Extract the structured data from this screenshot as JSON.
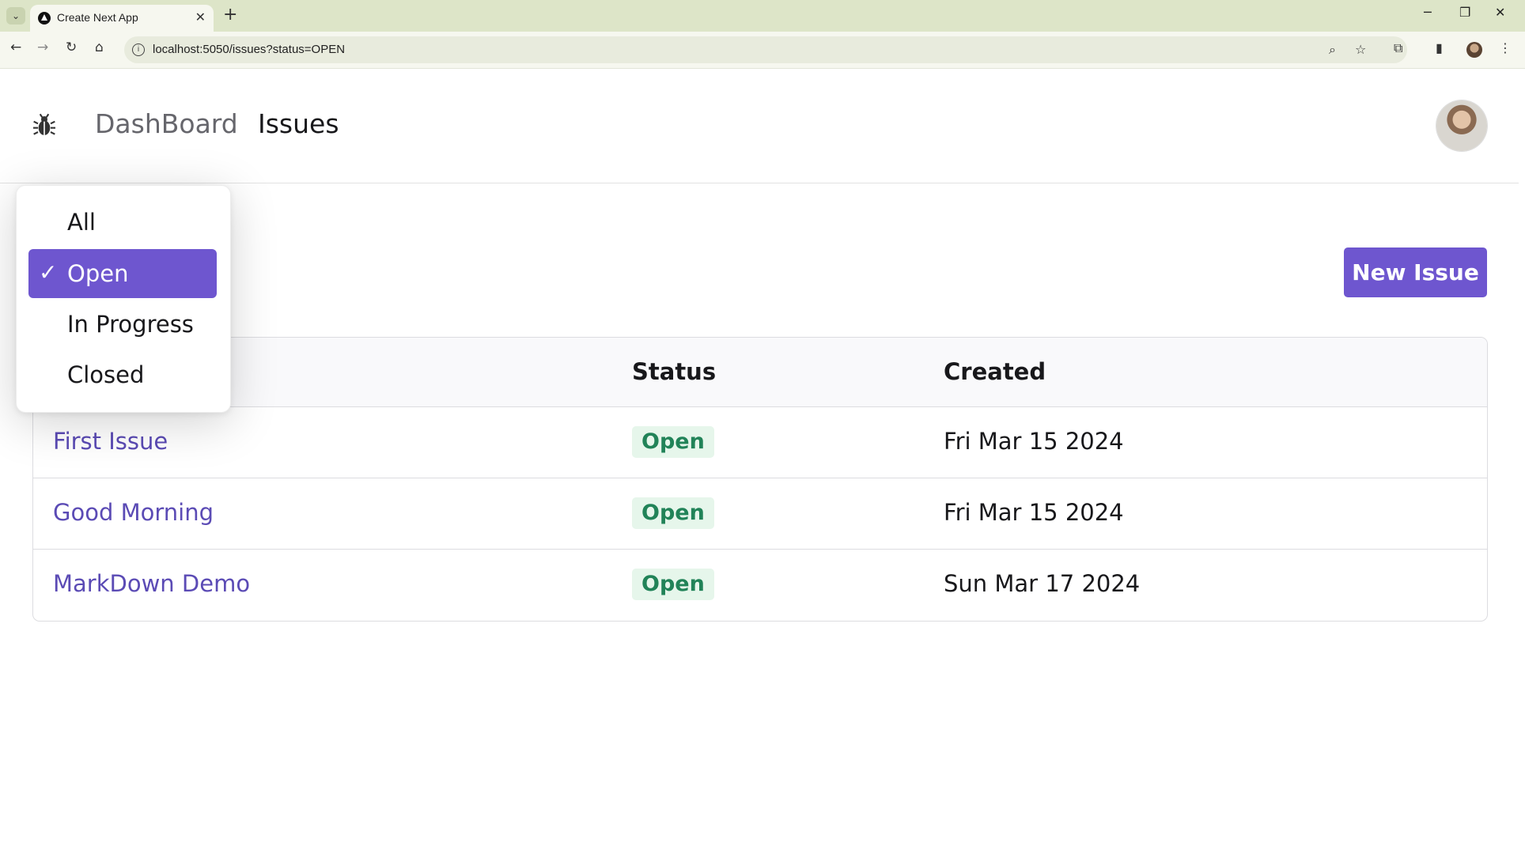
{
  "browser": {
    "tab_title": "Create Next App",
    "url": "localhost:5050/issues?status=OPEN"
  },
  "nav": {
    "dashboard": "DashBoard",
    "issues": "Issues"
  },
  "new_issue_button": "New Issue",
  "status_filter": {
    "options": [
      "All",
      "Open",
      "In Progress",
      "Closed"
    ],
    "selected": "Open",
    "check_glyph": "✓"
  },
  "table": {
    "headers": [
      "Status",
      "Created"
    ],
    "rows": [
      {
        "title": "First Issue",
        "status": "Open",
        "created": "Fri Mar 15 2024"
      },
      {
        "title": "Good Morning",
        "status": "Open",
        "created": "Fri Mar 15 2024"
      },
      {
        "title": "MarkDown Demo",
        "status": "Open",
        "created": "Sun Mar 17 2024"
      }
    ]
  },
  "colors": {
    "accent": "#6e56cf",
    "link": "#5b4bb5",
    "badge_bg": "#e6f6eb",
    "badge_text": "#218358",
    "browser_frame": "#dde5c8"
  }
}
